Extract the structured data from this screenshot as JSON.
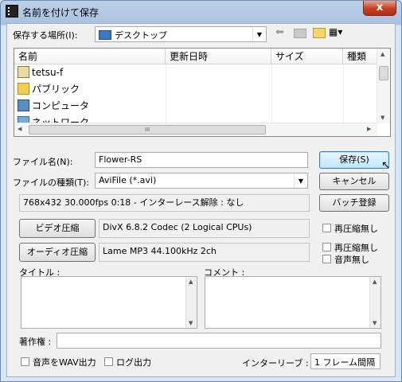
{
  "window": {
    "title": "名前を付けて保存",
    "close_glyph": "x"
  },
  "location": {
    "label": "保存する場所(I):",
    "value": "デスクトップ"
  },
  "toolbar": {
    "back_glyph": "⬅",
    "view_glyph": "▦▾"
  },
  "listview": {
    "columns": [
      "名前",
      "更新日時",
      "サイズ",
      "種類"
    ],
    "items": [
      {
        "name": "tetsu-f",
        "icon": "user-folder-icon"
      },
      {
        "name": "パブリック",
        "icon": "folder-icon"
      },
      {
        "name": "コンピュータ",
        "icon": "computer-icon"
      },
      {
        "name": "ネットワーク",
        "icon": "network-icon"
      }
    ],
    "hscroll_grip": "III"
  },
  "filename": {
    "label": "ファイル名(N):",
    "value": "Flower-RS"
  },
  "filetype": {
    "label": "ファイルの種類(T):",
    "value": "AviFile (*.avi)"
  },
  "buttons": {
    "save": "保存(S)",
    "cancel": "キャンセル",
    "batch": "バッチ登録"
  },
  "info": "768x432  30.000fps  0:18  -  インターレース解除 : なし",
  "video": {
    "button": "ビデオ圧縮",
    "codec": "DivX  6.8.2 Codec (2 Logical CPUs)",
    "no_recompress": "再圧縮無し"
  },
  "audio": {
    "button": "オーディオ圧縮",
    "codec": "Lame MP3 44.100kHz 2ch",
    "no_recompress": "再圧縮無し",
    "no_audio": "音声無し"
  },
  "title_label": "タイトル :",
  "comment_label": "コメント :",
  "copyright_label": "著作権 :",
  "wav_output": "音声をWAV出力",
  "log_output": "ログ出力",
  "interleave": {
    "label": "インターリーブ :",
    "value": "1 フレーム間隔"
  }
}
